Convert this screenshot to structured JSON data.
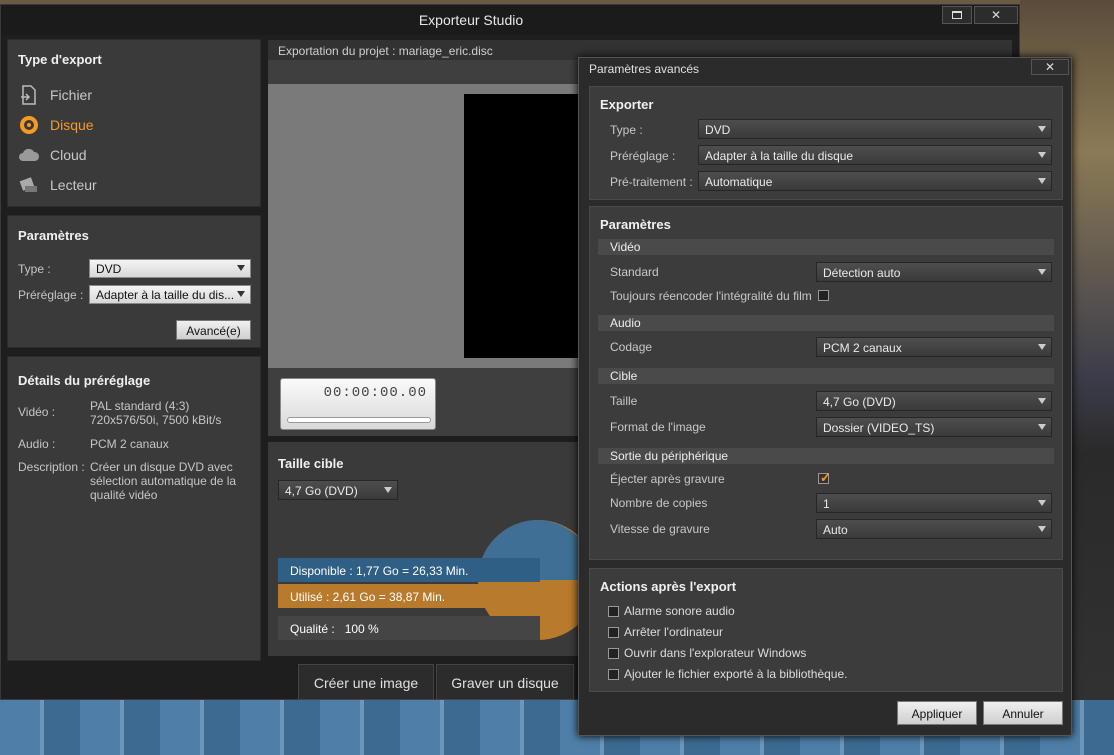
{
  "window": {
    "title": "Exporteur Studio",
    "restore_icon": "restore-icon",
    "close_icon": "close-icon"
  },
  "export_type": {
    "title": "Type d'export",
    "items": [
      {
        "label": "Fichier",
        "icon": "file-icon"
      },
      {
        "label": "Disque",
        "icon": "disc-icon",
        "active": true
      },
      {
        "label": "Cloud",
        "icon": "cloud-icon"
      },
      {
        "label": "Lecteur",
        "icon": "device-icon"
      }
    ]
  },
  "params": {
    "title": "Paramètres",
    "type_label": "Type :",
    "type_value": "DVD",
    "preset_label": "Préréglage :",
    "preset_value": "Adapter à la taille du dis...",
    "advanced_button": "Avancé(e)"
  },
  "preset_details": {
    "title": "Détails du préréglage",
    "video_label": "Vidéo :",
    "video_value": "PAL standard (4:3)\n720x576/50i, 7500 kBit/s",
    "audio_label": "Audio :",
    "audio_value": "PCM 2 canaux",
    "desc_label": "Description :",
    "desc_value": "Créer un disque DVD avec sélection automatique de la qualité vidéo"
  },
  "preview": {
    "project_label": "Exportation du projet : mariage_eric.disc",
    "timecode": "00:00:00.00"
  },
  "target": {
    "title": "Taille cible",
    "size_value": "4,7 Go (DVD)",
    "available": "Disponible : 1,77 Go = 26,33 Min.",
    "used": "Utilisé : 2,61 Go = 38,87 Min.",
    "quality": "Qualité :   100 %"
  },
  "bottom": {
    "create_image": "Créer une image",
    "burn_disc": "Graver un disque"
  },
  "advanced": {
    "title": "Paramètres avancés",
    "export": {
      "title": "Exporter",
      "type_label": "Type :",
      "type_value": "DVD",
      "preset_label": "Préréglage :",
      "preset_value": "Adapter à la taille du disque",
      "preproc_label": "Pré-traitement :",
      "preproc_value": "Automatique"
    },
    "settings": {
      "title": "Paramètres",
      "video_head": "Vidéo",
      "standard_label": "Standard",
      "standard_value": "Détection auto",
      "reencode_label": "Toujours réencoder l'intégralité du film",
      "audio_head": "Audio",
      "codec_label": "Codage",
      "codec_value": "PCM 2 canaux",
      "target_head": "Cible",
      "size_label": "Taille",
      "size_value": "4,7 Go (DVD)",
      "image_label": "Format de l'image",
      "image_value": "Dossier (VIDEO_TS)",
      "device_head": "Sortie du périphérique",
      "eject_label": "Éjecter après gravure",
      "copies_label": "Nombre de copies",
      "copies_value": "1",
      "speed_label": "Vitesse de gravure",
      "speed_value": "Auto"
    },
    "actions": {
      "title": "Actions après l'export",
      "items": [
        "Alarme sonore audio",
        "Arrêter l'ordinateur",
        "Ouvrir dans l'explorateur Windows",
        "Ajouter le fichier exporté à la bibliothèque."
      ]
    },
    "apply_button": "Appliquer",
    "cancel_button": "Annuler"
  },
  "colors": {
    "accent": "#f49b24",
    "available": "#2f5f84",
    "used": "#b87a2c"
  }
}
